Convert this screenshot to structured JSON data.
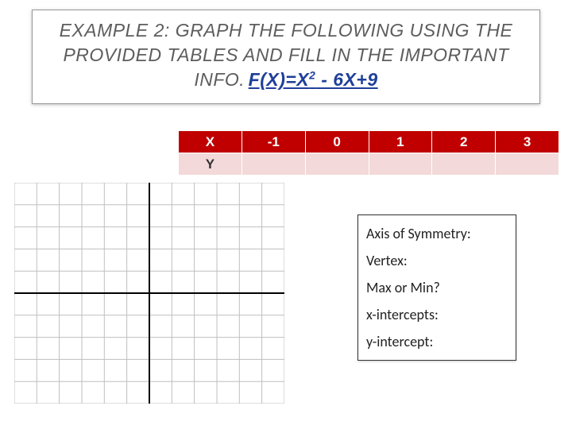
{
  "title": {
    "main": "EXAMPLE 2: GRAPH THE FOLLOWING USING THE PROVIDED TABLES AND FILL IN THE IMPORTANT INFO.",
    "fx_prefix": "F(X)=X",
    "fx_exp": "2",
    "fx_suffix": " - 6X+9"
  },
  "table": {
    "row_labels": [
      "X",
      "Y"
    ],
    "x_values": [
      "-1",
      "0",
      "1",
      "2",
      "3"
    ],
    "y_values": [
      "",
      "",
      "",
      "",
      ""
    ]
  },
  "info": {
    "axis": "Axis of Symmetry:",
    "vertex": "Vertex:",
    "maxmin": "Max or Min?",
    "xint": "x-intercepts:",
    "yint": "y-intercept:"
  },
  "chart_data": {
    "type": "scatter",
    "title": "",
    "xlabel": "",
    "ylabel": "",
    "xlim": [
      -6,
      6
    ],
    "ylim": [
      -5,
      5
    ],
    "grid": true,
    "series": []
  }
}
